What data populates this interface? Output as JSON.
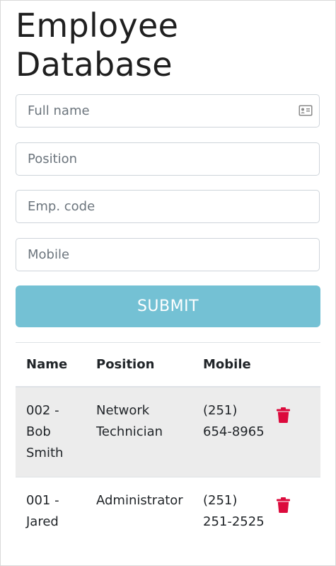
{
  "page_title": "Employee Database",
  "form": {
    "full_name_placeholder": "Full name",
    "position_placeholder": "Position",
    "emp_code_placeholder": "Emp. code",
    "mobile_placeholder": "Mobile",
    "submit_label": "SUBMIT",
    "card_icon": "id-card-icon"
  },
  "table": {
    "headers": [
      "Name",
      "Position",
      "Mobile",
      ""
    ],
    "rows": [
      {
        "name": "002 - Bob Smith",
        "position": "Network Technician",
        "mobile": "(251) 654-8965",
        "action_icon": "trash-icon"
      },
      {
        "name": "001 - Jared",
        "position": "Administrator",
        "mobile": "(251) 251-2525",
        "action_icon": "trash-icon"
      }
    ]
  },
  "colors": {
    "submit_bg": "#74c1d4",
    "delete_icon": "#dc0a3c",
    "striped_row": "#ececec"
  }
}
